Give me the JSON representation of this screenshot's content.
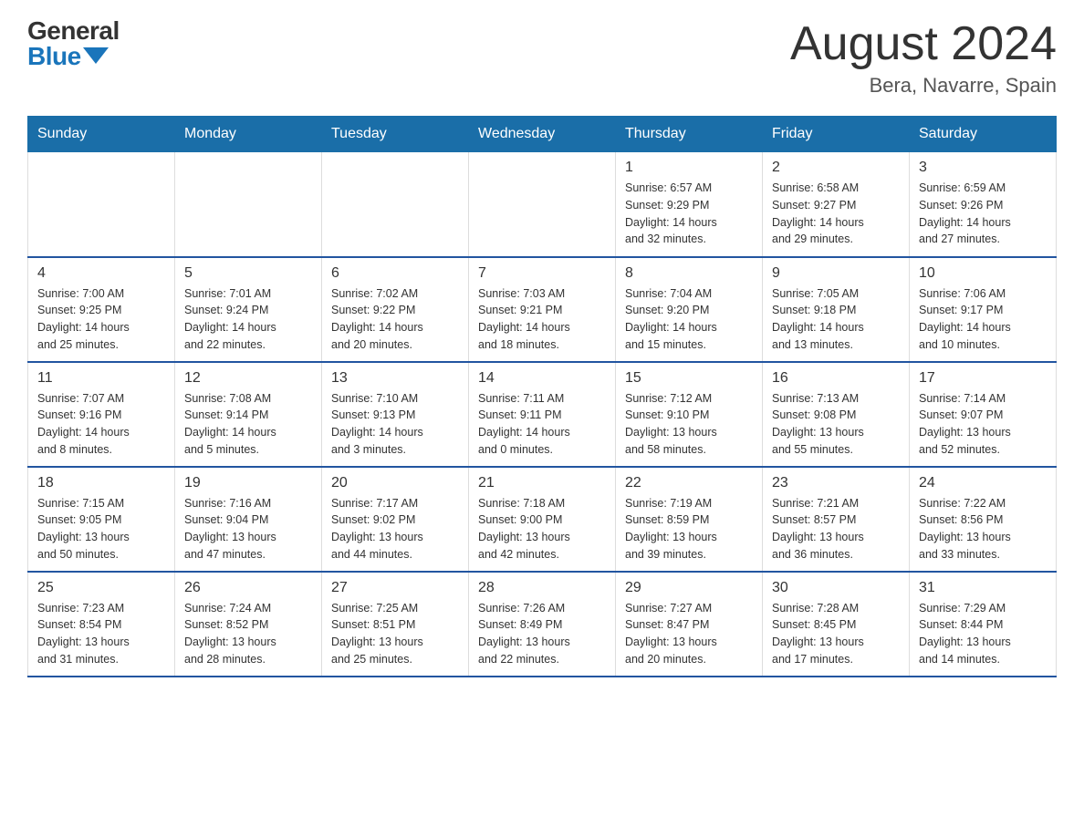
{
  "logo": {
    "general": "General",
    "blue": "Blue"
  },
  "header": {
    "month": "August 2024",
    "location": "Bera, Navarre, Spain"
  },
  "weekdays": [
    "Sunday",
    "Monday",
    "Tuesday",
    "Wednesday",
    "Thursday",
    "Friday",
    "Saturday"
  ],
  "weeks": [
    [
      {
        "day": "",
        "info": ""
      },
      {
        "day": "",
        "info": ""
      },
      {
        "day": "",
        "info": ""
      },
      {
        "day": "",
        "info": ""
      },
      {
        "day": "1",
        "info": "Sunrise: 6:57 AM\nSunset: 9:29 PM\nDaylight: 14 hours\nand 32 minutes."
      },
      {
        "day": "2",
        "info": "Sunrise: 6:58 AM\nSunset: 9:27 PM\nDaylight: 14 hours\nand 29 minutes."
      },
      {
        "day": "3",
        "info": "Sunrise: 6:59 AM\nSunset: 9:26 PM\nDaylight: 14 hours\nand 27 minutes."
      }
    ],
    [
      {
        "day": "4",
        "info": "Sunrise: 7:00 AM\nSunset: 9:25 PM\nDaylight: 14 hours\nand 25 minutes."
      },
      {
        "day": "5",
        "info": "Sunrise: 7:01 AM\nSunset: 9:24 PM\nDaylight: 14 hours\nand 22 minutes."
      },
      {
        "day": "6",
        "info": "Sunrise: 7:02 AM\nSunset: 9:22 PM\nDaylight: 14 hours\nand 20 minutes."
      },
      {
        "day": "7",
        "info": "Sunrise: 7:03 AM\nSunset: 9:21 PM\nDaylight: 14 hours\nand 18 minutes."
      },
      {
        "day": "8",
        "info": "Sunrise: 7:04 AM\nSunset: 9:20 PM\nDaylight: 14 hours\nand 15 minutes."
      },
      {
        "day": "9",
        "info": "Sunrise: 7:05 AM\nSunset: 9:18 PM\nDaylight: 14 hours\nand 13 minutes."
      },
      {
        "day": "10",
        "info": "Sunrise: 7:06 AM\nSunset: 9:17 PM\nDaylight: 14 hours\nand 10 minutes."
      }
    ],
    [
      {
        "day": "11",
        "info": "Sunrise: 7:07 AM\nSunset: 9:16 PM\nDaylight: 14 hours\nand 8 minutes."
      },
      {
        "day": "12",
        "info": "Sunrise: 7:08 AM\nSunset: 9:14 PM\nDaylight: 14 hours\nand 5 minutes."
      },
      {
        "day": "13",
        "info": "Sunrise: 7:10 AM\nSunset: 9:13 PM\nDaylight: 14 hours\nand 3 minutes."
      },
      {
        "day": "14",
        "info": "Sunrise: 7:11 AM\nSunset: 9:11 PM\nDaylight: 14 hours\nand 0 minutes."
      },
      {
        "day": "15",
        "info": "Sunrise: 7:12 AM\nSunset: 9:10 PM\nDaylight: 13 hours\nand 58 minutes."
      },
      {
        "day": "16",
        "info": "Sunrise: 7:13 AM\nSunset: 9:08 PM\nDaylight: 13 hours\nand 55 minutes."
      },
      {
        "day": "17",
        "info": "Sunrise: 7:14 AM\nSunset: 9:07 PM\nDaylight: 13 hours\nand 52 minutes."
      }
    ],
    [
      {
        "day": "18",
        "info": "Sunrise: 7:15 AM\nSunset: 9:05 PM\nDaylight: 13 hours\nand 50 minutes."
      },
      {
        "day": "19",
        "info": "Sunrise: 7:16 AM\nSunset: 9:04 PM\nDaylight: 13 hours\nand 47 minutes."
      },
      {
        "day": "20",
        "info": "Sunrise: 7:17 AM\nSunset: 9:02 PM\nDaylight: 13 hours\nand 44 minutes."
      },
      {
        "day": "21",
        "info": "Sunrise: 7:18 AM\nSunset: 9:00 PM\nDaylight: 13 hours\nand 42 minutes."
      },
      {
        "day": "22",
        "info": "Sunrise: 7:19 AM\nSunset: 8:59 PM\nDaylight: 13 hours\nand 39 minutes."
      },
      {
        "day": "23",
        "info": "Sunrise: 7:21 AM\nSunset: 8:57 PM\nDaylight: 13 hours\nand 36 minutes."
      },
      {
        "day": "24",
        "info": "Sunrise: 7:22 AM\nSunset: 8:56 PM\nDaylight: 13 hours\nand 33 minutes."
      }
    ],
    [
      {
        "day": "25",
        "info": "Sunrise: 7:23 AM\nSunset: 8:54 PM\nDaylight: 13 hours\nand 31 minutes."
      },
      {
        "day": "26",
        "info": "Sunrise: 7:24 AM\nSunset: 8:52 PM\nDaylight: 13 hours\nand 28 minutes."
      },
      {
        "day": "27",
        "info": "Sunrise: 7:25 AM\nSunset: 8:51 PM\nDaylight: 13 hours\nand 25 minutes."
      },
      {
        "day": "28",
        "info": "Sunrise: 7:26 AM\nSunset: 8:49 PM\nDaylight: 13 hours\nand 22 minutes."
      },
      {
        "day": "29",
        "info": "Sunrise: 7:27 AM\nSunset: 8:47 PM\nDaylight: 13 hours\nand 20 minutes."
      },
      {
        "day": "30",
        "info": "Sunrise: 7:28 AM\nSunset: 8:45 PM\nDaylight: 13 hours\nand 17 minutes."
      },
      {
        "day": "31",
        "info": "Sunrise: 7:29 AM\nSunset: 8:44 PM\nDaylight: 13 hours\nand 14 minutes."
      }
    ]
  ]
}
